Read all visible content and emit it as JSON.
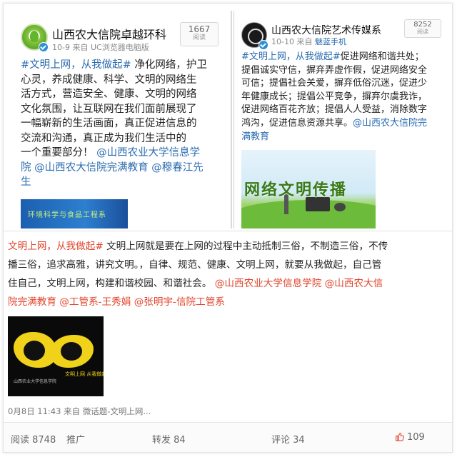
{
  "post_left": {
    "account_name": "山西农大信院卓越环科",
    "meta_date": "10-9",
    "meta_source": "来自 UC浏览器电脑版",
    "read_count": "1667",
    "read_label": "阅读",
    "hashtag": "#文明上网，从我做起#",
    "body_lines": [
      "净化网络，护卫",
      "心灵，养成健康、科学、文明的网络生",
      "活方式，营造安全、健康、文明的网络",
      "文化氛围，让互联网在我们面前展现了",
      "一幅崭新的生活画面，真正促进信息的",
      "交流和沟通，真正成为我们生活中的",
      "一个重要部分！"
    ],
    "mention_1": "@山西农业大学信息学",
    "mention_1b": "院",
    "mention_2": "@山西农大信院完满教育",
    "mention_3": "@穆春江先",
    "mention_3b": "生",
    "image_caption": "环境科学与食品工程系",
    "avatar_icon": "leaf-logo-icon"
  },
  "post_right": {
    "account_name": "山西农大信院艺术传媒系",
    "meta_date": "10-10",
    "meta_source_prefix": "来自",
    "meta_source": "魅蓝手机",
    "read_count": "8252",
    "read_label": "阅读",
    "hashtag": "#文明上网，从我做起#",
    "body_lines": [
      "促进网络和谐共处；",
      "提倡诚实守信，摒弃弄虚作假，促进网络安全",
      "可信；提倡社会关爱，摒弃低俗沉迷，促进少",
      "年健康成长；提倡公平竞争，摒弃尔虞我诈，",
      "促进网络百花齐放；提倡人人受益，消除数字",
      "鸿沟，促进信息资源共享。"
    ],
    "mention_1": "@山西农大信院完",
    "mention_1b": "满教育",
    "image_title": "网络文明传播",
    "avatar_icon": "circle-logo-icon"
  },
  "post_bottom": {
    "hashtag": "文明上网，从我做起#",
    "line1_text": " 文明上网就是要在上网的过程中主动抵制三俗，不制造三俗，不传",
    "line2_text": "播三俗，追求高雅，讲究文明。，自律、规范、健康、文明上网，就要从我做起，自己管",
    "line3_text": "住自己，文明上网，构建和谐校园、和谐社会。",
    "line3_mention_1": "@山西农业大学信息学院",
    "line3_mention_2": "@山西农大信",
    "line4_mention_1": "院完满教育",
    "line4_mention_2": "@工管系-王秀娟",
    "line4_mention_3": "@张明宇-信院工管系",
    "meta": "0月8日 11:43 来自 微话题-文明上网...",
    "image_caption_1": "文明上网 从我做起",
    "image_caption_2": "山西农业大学信息学院"
  },
  "action_bar": {
    "read": "阅读 8748",
    "promote": "推广",
    "forward": "转发 84",
    "comment": "评论 34",
    "like": "109",
    "like_icon": "thumbs-up-icon"
  },
  "colors": {
    "link_blue": "#2b6cb0",
    "hashtag_red": "#e0442c",
    "verified_blue": "#2b8fd6"
  }
}
